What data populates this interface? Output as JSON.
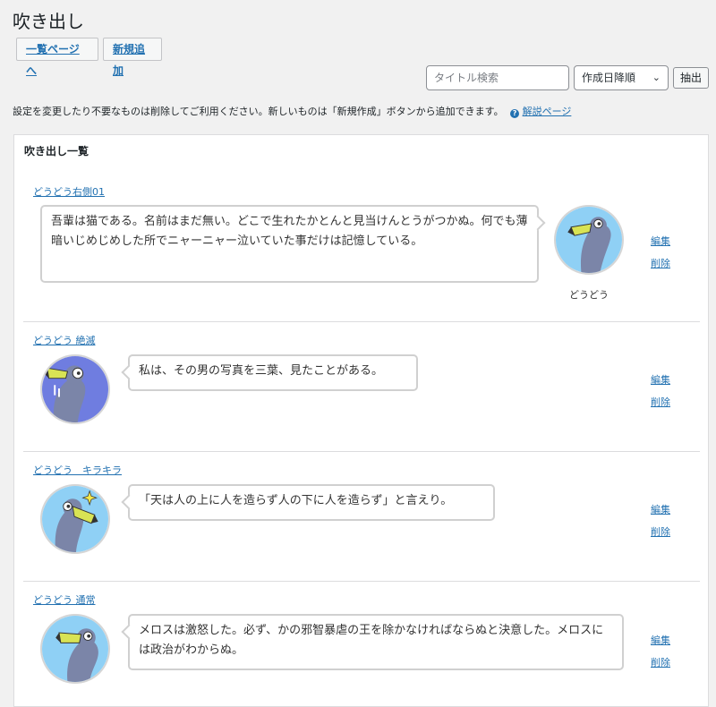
{
  "header": {
    "title": "吹き出し",
    "list_button": "一覧ページへ",
    "new_button": "新規追加"
  },
  "filters": {
    "search_placeholder": "タイトル検索",
    "sort_selected": "作成日降順",
    "extract_button": "抽出"
  },
  "description": {
    "text": "設定を変更したり不要なものは削除してご利用ください。新しいものは「新規作成」ボタンから追加できます。",
    "help_link": "解説ページ"
  },
  "panel": {
    "title": "吹き出し一覧",
    "items": [
      {
        "title": "どうどう右側01",
        "text": "吾輩は猫である。名前はまだ無い。どこで生れたかとんと見当けんとうがつかぬ。何でも薄暗いじめじめした所でニャーニャー泣いていた事だけは記憶している。",
        "avatar_name": "どうどう",
        "edit": "編集",
        "delete": "削除"
      },
      {
        "title": "どうどう 絶滅",
        "text": "私は、その男の写真を三葉、見たことがある。",
        "edit": "編集",
        "delete": "削除"
      },
      {
        "title": "どうどう　キラキラ",
        "text": "「天は人の上に人を造らず人の下に人を造らず」と言えり。",
        "edit": "編集",
        "delete": "削除"
      },
      {
        "title": "どうどう 通常",
        "text": "メロスは激怒した。必ず、かの邪智暴虐の王を除かなければならぬと決意した。メロスには政治がわからぬ。",
        "edit": "編集",
        "delete": "削除"
      }
    ]
  },
  "colors": {
    "link": "#2271b1",
    "avatar_bg_blue": "#8fd0f5",
    "avatar_bg_purple": "#6f7de0",
    "bird_body": "#7b85a8",
    "bird_beak": "#d8e354"
  }
}
